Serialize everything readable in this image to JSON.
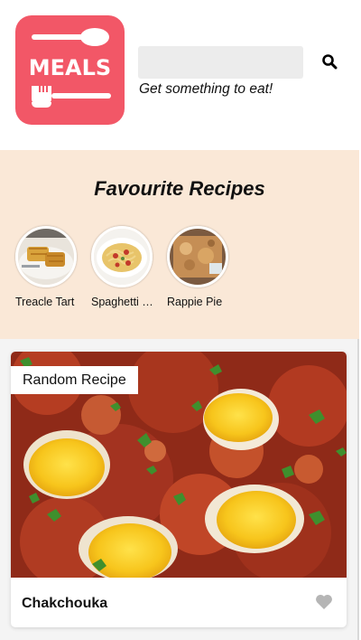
{
  "app": {
    "logo_text": "MEALS",
    "tagline": "Get something to eat!"
  },
  "search": {
    "value": "",
    "placeholder": ""
  },
  "favourites": {
    "title": "Favourite Recipes",
    "items": [
      {
        "label": "Treacle Tart"
      },
      {
        "label": "Spaghetti Bolognese"
      },
      {
        "label": "Rappie Pie"
      }
    ]
  },
  "random_recipe": {
    "badge": "Random Recipe",
    "title": "Chakchouka",
    "favourited": false
  },
  "icons": {
    "search": "search-icon",
    "heart": "heart-icon"
  },
  "colors": {
    "brand": "#f25767",
    "favourites_bg": "#fae8d7",
    "heart_inactive": "#b5b5b5"
  }
}
